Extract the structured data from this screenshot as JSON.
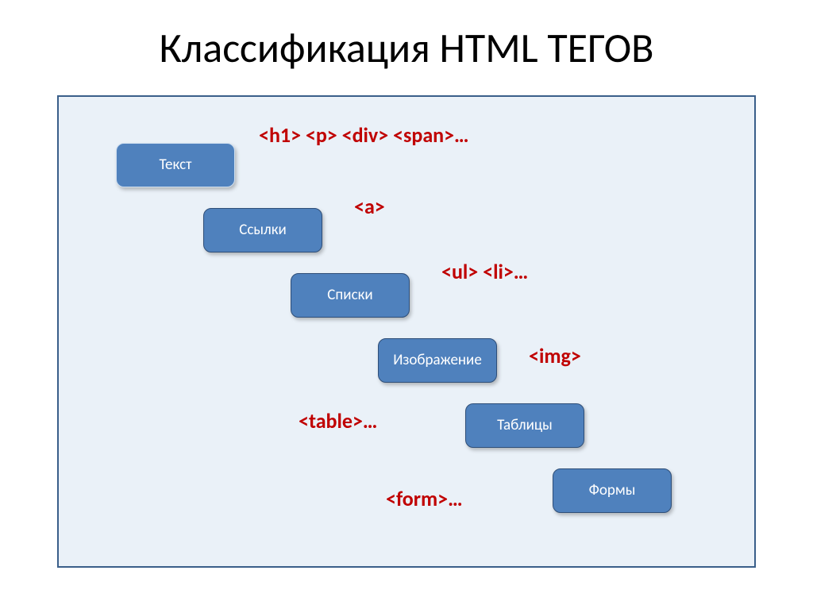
{
  "title": "Классификация HTML ТЕГОВ",
  "steps": [
    {
      "label": "Текст",
      "tags": "<h1> <p> <div> <span>…"
    },
    {
      "label": "Ссылки",
      "tags": "<a>"
    },
    {
      "label": "Списки",
      "tags": "<ul> <li>…"
    },
    {
      "label": "Изображение",
      "tags": "<img>"
    },
    {
      "label": "Таблицы",
      "tags": "<table>…"
    },
    {
      "label": "Формы",
      "tags": "<form>…"
    }
  ]
}
